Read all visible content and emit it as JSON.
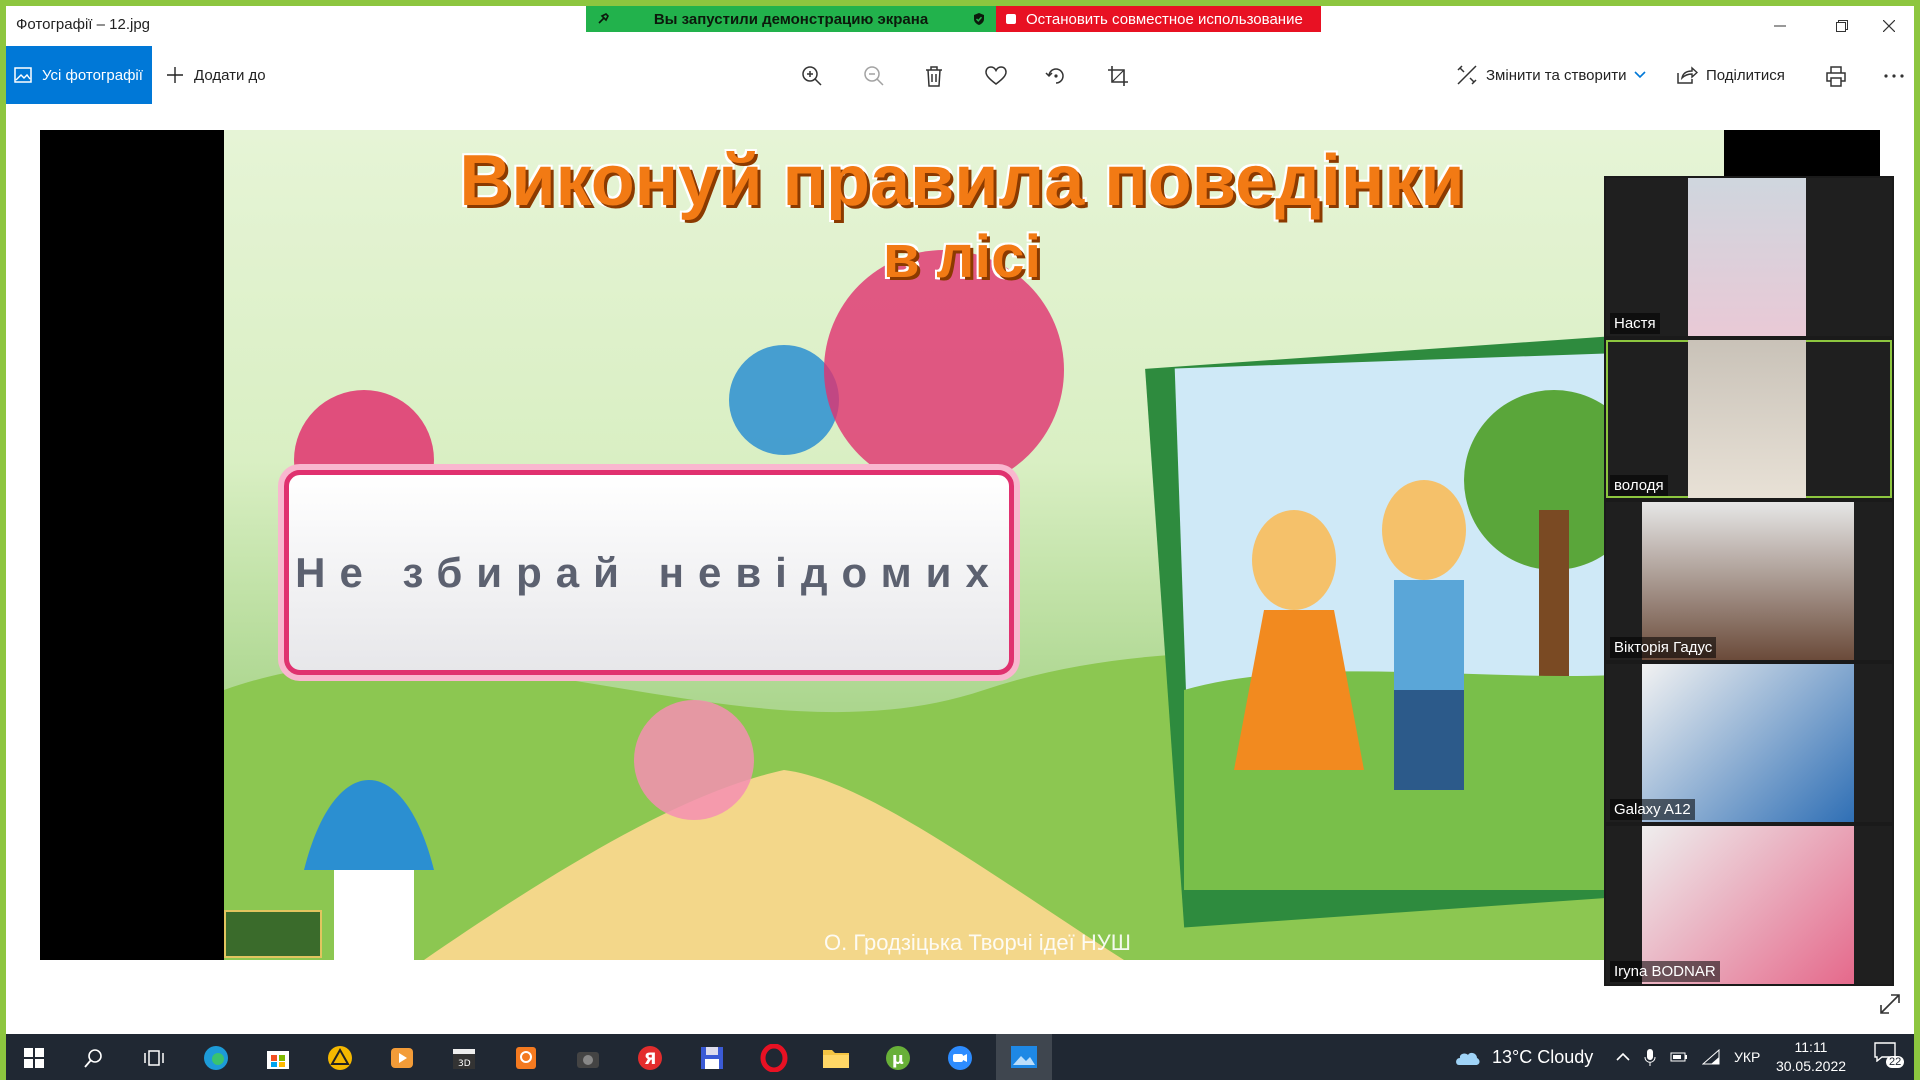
{
  "window": {
    "title": "Фотографії – 12.jpg",
    "share_banner": "Вы запустили демонстрацию экрана",
    "stop_share": "Остановить совместное использование"
  },
  "toolbar": {
    "all_photos": "Усі фотографії",
    "add_to": "Додати до",
    "edit_create": "Змінити та створити",
    "share": "Поділитися"
  },
  "slide": {
    "title_line1": "Виконуй правила поведінки",
    "title_line2": "в лісі",
    "caption": "Не збирай невідомих",
    "credit": "О. Гродзіцька Творчі ідеї НУШ",
    "logo_text": "Творчі ідеї НУШ"
  },
  "participants": [
    {
      "name": "Настя",
      "active": false
    },
    {
      "name": "володя",
      "active": true
    },
    {
      "name": "Вікторія Гадус",
      "active": false
    },
    {
      "name": "Galaxy A12",
      "active": false
    },
    {
      "name": "Iryna BODNAR",
      "active": false
    }
  ],
  "taskbar": {
    "weather": "13°C  Cloudy",
    "language": "УКР",
    "time": "11:11",
    "date": "30.05.2022",
    "notifications": "22"
  },
  "colors": {
    "accent": "#0078d7",
    "frame_border": "#8dc63f",
    "share_green": "#22b24c",
    "share_red": "#e81123",
    "taskbar": "#202833"
  }
}
